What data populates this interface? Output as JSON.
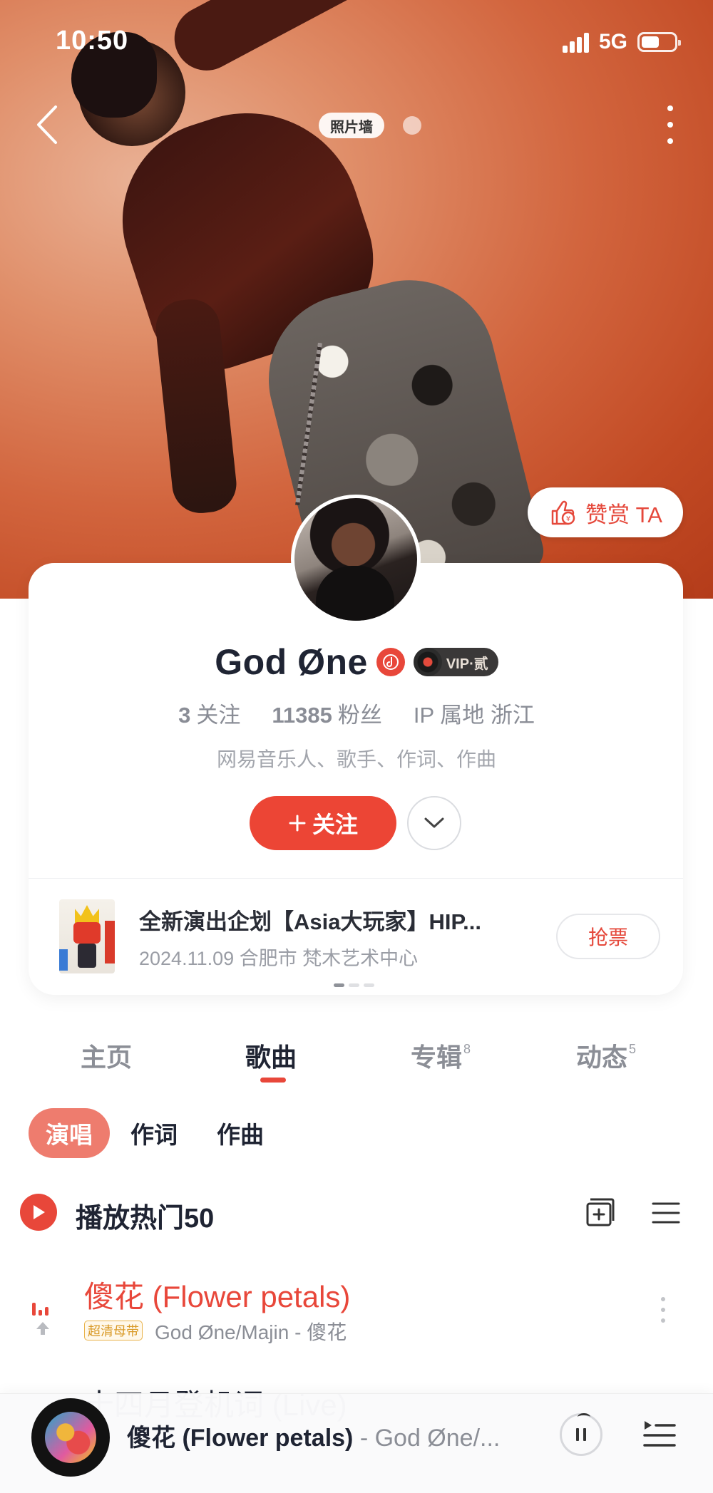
{
  "status_bar": {
    "time": "10:50",
    "network": "5G",
    "battery_level": 0.55
  },
  "nav": {
    "photo_wall_label": "照片墙"
  },
  "reward": {
    "label": "赞赏 TA"
  },
  "profile": {
    "name": "God Øne",
    "vip_label": "VIP·贰",
    "stats": [
      {
        "value": "3",
        "label": "关注"
      },
      {
        "value": "11385",
        "label": "粉丝"
      },
      {
        "value": "",
        "label": "IP 属地 浙江"
      }
    ],
    "bio": "网易音乐人、歌手、作词、作曲",
    "follow_label": "关注"
  },
  "event": {
    "title": "全新演出企划【Asia大玩家】HIP...",
    "subtitle": "2024.11.09 合肥市 梵木艺术中心",
    "ticket_label": "抢票"
  },
  "tabs": [
    {
      "label": "主页",
      "count": ""
    },
    {
      "label": "歌曲",
      "count": ""
    },
    {
      "label": "专辑",
      "count": "8"
    },
    {
      "label": "动态",
      "count": "5"
    }
  ],
  "filters": [
    "演唱",
    "作词",
    "作曲"
  ],
  "hot": {
    "label": "播放热门50"
  },
  "songs": [
    {
      "title": "傻花 (Flower petals)",
      "quality": "超清母带",
      "meta": "God Øne/Majin - 傻花"
    },
    {
      "title": "十四月登机词 (Live)"
    }
  ],
  "player": {
    "title": "傻花 (Flower petals)",
    "artist": " - God Øne/..."
  }
}
